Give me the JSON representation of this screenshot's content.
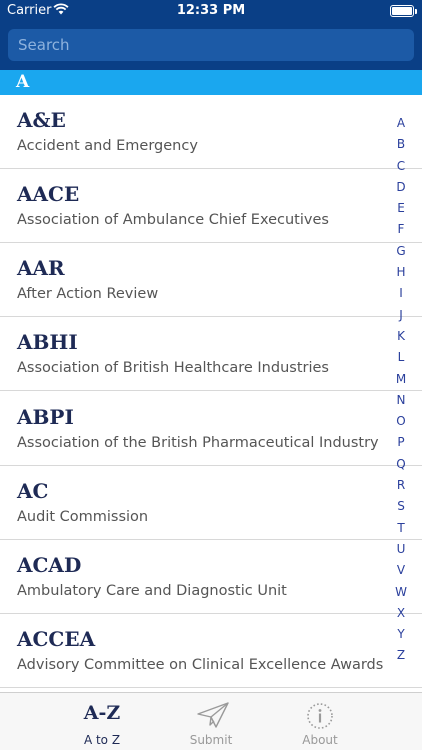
{
  "status_bar": {
    "carrier": "Carrier",
    "time": "12:33 PM"
  },
  "search": {
    "placeholder": "Search"
  },
  "section": {
    "letter": "A"
  },
  "entries": [
    {
      "abbr": "A&E",
      "full": "Accident and Emergency"
    },
    {
      "abbr": "AACE",
      "full": "Association of Ambulance Chief Executives"
    },
    {
      "abbr": "AAR",
      "full": "After Action Review"
    },
    {
      "abbr": "ABHI",
      "full": "Association of British Healthcare Industries"
    },
    {
      "abbr": "ABPI",
      "full": "Association of the British Pharmaceutical Industry"
    },
    {
      "abbr": "AC",
      "full": "Audit Commission"
    },
    {
      "abbr": "ACAD",
      "full": "Ambulatory Care and Diagnostic Unit"
    },
    {
      "abbr": "ACCEA",
      "full": "Advisory Committee on Clinical Excellence Awards"
    }
  ],
  "index_letters": [
    "A",
    "B",
    "C",
    "D",
    "E",
    "F",
    "G",
    "H",
    "I",
    "J",
    "K",
    "L",
    "M",
    "N",
    "O",
    "P",
    "Q",
    "R",
    "S",
    "T",
    "U",
    "V",
    "W",
    "X",
    "Y",
    "Z"
  ],
  "tabs": [
    {
      "label": "A to Z",
      "icon_text": "A-Z",
      "icon": "az-icon",
      "active": true
    },
    {
      "label": "Submit",
      "icon": "paper-plane-icon",
      "active": false
    },
    {
      "label": "About",
      "icon": "info-icon",
      "active": false
    }
  ]
}
